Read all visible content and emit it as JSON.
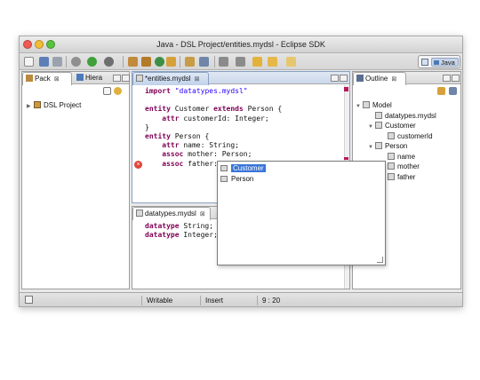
{
  "window": {
    "title": "Java - DSL Project/entities.mydsl - Eclipse SDK",
    "perspective_label": "Java"
  },
  "colors": {
    "close": "#f25a4f",
    "minimize": "#f4bd32",
    "zoom": "#59c33c",
    "selection": "#3875d7",
    "keyword": "#7f0055",
    "string": "#2a00ff"
  },
  "left_panel": {
    "tabs": [
      {
        "label": "Pack",
        "close": "⊠"
      },
      {
        "label": "Hiera",
        "close": ""
      }
    ],
    "tree": [
      {
        "label": "DSL Project",
        "icon": "project-folder-icon"
      }
    ]
  },
  "editor": {
    "tab": {
      "label": "*entities.mydsl",
      "close": "⊠"
    },
    "lines": [
      [
        {
          "t": "kw",
          "v": "import"
        },
        {
          "t": "txt",
          "v": " "
        },
        {
          "t": "str",
          "v": "\"datatypes.mydsl\""
        }
      ],
      [],
      [
        {
          "t": "kw",
          "v": "entity"
        },
        {
          "t": "txt",
          "v": " Customer "
        },
        {
          "t": "kw",
          "v": "extends"
        },
        {
          "t": "txt",
          "v": " Person {"
        }
      ],
      [
        {
          "t": "txt",
          "v": "    "
        },
        {
          "t": "kw",
          "v": "attr"
        },
        {
          "t": "txt",
          "v": " customerId: Integer;"
        }
      ],
      [
        {
          "t": "txt",
          "v": "}"
        }
      ],
      [
        {
          "t": "kw",
          "v": "entity"
        },
        {
          "t": "txt",
          "v": " Person {"
        }
      ],
      [
        {
          "t": "txt",
          "v": "    "
        },
        {
          "t": "kw",
          "v": "attr"
        },
        {
          "t": "txt",
          "v": " name: String;"
        }
      ],
      [
        {
          "t": "txt",
          "v": "    "
        },
        {
          "t": "kw",
          "v": "assoc"
        },
        {
          "t": "txt",
          "v": " mother: Person;"
        }
      ],
      [
        {
          "t": "txt",
          "v": "    "
        },
        {
          "t": "kw",
          "v": "assoc"
        },
        {
          "t": "txt",
          "v": " father: |"
        }
      ]
    ]
  },
  "completion": {
    "items": [
      {
        "label": "Customer",
        "selected": true
      },
      {
        "label": "Person",
        "selected": false
      }
    ]
  },
  "bottom_editor": {
    "tab": {
      "label": "datatypes.mydsl",
      "close": "⊠"
    },
    "lines": [
      [
        {
          "t": "kw",
          "v": "datatype"
        },
        {
          "t": "txt",
          "v": " String;"
        }
      ],
      [
        {
          "t": "kw",
          "v": "datatype"
        },
        {
          "t": "txt",
          "v": " Integer;"
        }
      ]
    ]
  },
  "outline": {
    "tab": {
      "label": "Outline",
      "close": "⊠"
    },
    "tree": [
      {
        "label": "Model",
        "level": 0,
        "toggle": "▼"
      },
      {
        "label": "datatypes.mydsl",
        "level": 1,
        "toggle": ""
      },
      {
        "label": "Customer",
        "level": 1,
        "toggle": "▼"
      },
      {
        "label": "customerId",
        "level": 2,
        "toggle": ""
      },
      {
        "label": "Person",
        "level": 1,
        "toggle": "▼"
      },
      {
        "label": "name",
        "level": 2,
        "toggle": ""
      },
      {
        "label": "mother",
        "level": 2,
        "toggle": ""
      },
      {
        "label": "father",
        "level": 2,
        "toggle": ""
      }
    ]
  },
  "status": {
    "writable": "Writable",
    "insert_mode": "Insert",
    "position": "9 : 20"
  }
}
